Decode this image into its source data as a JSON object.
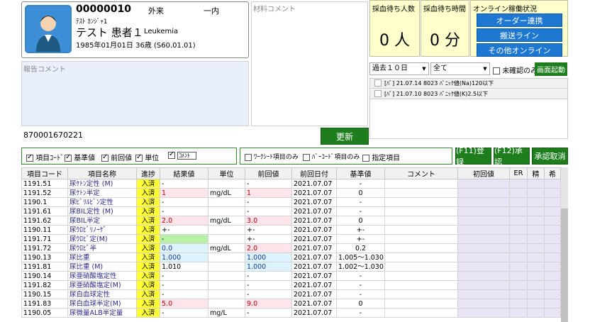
{
  "patient": {
    "id": "00000010",
    "dept": "外来",
    "ward": "一内",
    "kana": "ﾃｽﾄ  ｶﾝｼﾞｬ1",
    "name": "テスト  患者１",
    "diagnosis": "Leukemia",
    "dob": "1985年01月01日  36歳  (S60.01.01)"
  },
  "material_comment_label": "材料コメント",
  "report_comment_label": "報告コメント",
  "barcode": "870001670221",
  "update_button": "更新",
  "waiting": {
    "people_label": "採血待ち人数",
    "people_value": "0 人",
    "time_label": "採血待ち時間",
    "time_value": "0 分",
    "online_label": "オンライン稼働状況"
  },
  "online_buttons": [
    "オーダー連携",
    "搬送ライン",
    "その他オンライン"
  ],
  "period_select": "過去１０日",
  "all_select": "全て",
  "unconfirmed_label": "未確認のみ",
  "screen_start_button": "画面起動",
  "alerts": [
    "[ﾊﾟ] 21.07.14 8023 ﾊﾟﾆｯｸ値(Na)120以下",
    "[ﾊﾟ] 21.07.10 8023 ﾊﾟﾆｯｸ値(K)2.5以下"
  ],
  "filters_left": [
    {
      "label": "項目ｺｰﾄﾞ",
      "checked": true
    },
    {
      "label": "基準値",
      "checked": true
    },
    {
      "label": "前回値",
      "checked": true
    },
    {
      "label": "単位",
      "checked": true
    },
    {
      "label": "ｺﾒﾝﾄ",
      "checked": true
    }
  ],
  "filters_right": [
    {
      "label": "ﾜｰｸｼｰﾄ項目のみ",
      "checked": false
    },
    {
      "label": "ﾊﾞｰｺｰﾄﾞ項目のみ",
      "checked": false
    },
    {
      "label": "指定項目",
      "checked": false
    }
  ],
  "action_buttons": [
    "(F11)登録",
    "(F12)承認",
    "承認取消"
  ],
  "table": {
    "headers": [
      "項目コード",
      "項目名称",
      "進捗",
      "結果値",
      "単位",
      "前回値",
      "前回日付",
      "基準値",
      "コメント",
      "初回値",
      "ER",
      "精",
      "希"
    ],
    "rows": [
      {
        "code": "1191.51",
        "name": "尿ｹﾄﾝ定性 (M)",
        "prog": "入済",
        "result": "-",
        "unit": "",
        "prev": "-",
        "date": "2021.07.07",
        "ref": "-",
        "result_bg": "",
        "result_color": "",
        "prev_bg": "",
        "prev_color": ""
      },
      {
        "code": "1191.52",
        "name": "尿ｹﾄﾝ半定",
        "prog": "入済",
        "result": "1",
        "unit": "mg/dL",
        "prev": "1",
        "date": "2021.07.07",
        "ref": "0",
        "result_bg": "#ffe4ec",
        "result_color": "#c00000",
        "prev_bg": "#ffe4ec",
        "prev_color": "#c00000"
      },
      {
        "code": "1190.1",
        "name": "尿ﾋﾞﾘﾙﾋﾞﾝ定性",
        "prog": "入済",
        "result": "-",
        "unit": "",
        "prev": "-",
        "date": "2021.07.07",
        "ref": "-",
        "result_bg": "",
        "result_color": "",
        "prev_bg": "",
        "prev_color": ""
      },
      {
        "code": "1191.61",
        "name": "尿BIL定性 (M)",
        "prog": "入済",
        "result": "-",
        "unit": "",
        "prev": "-",
        "date": "2021.07.07",
        "ref": "-",
        "result_bg": "",
        "result_color": "",
        "prev_bg": "",
        "prev_color": ""
      },
      {
        "code": "1191.62",
        "name": "尿BIL半定",
        "prog": "入済",
        "result": "2.0",
        "unit": "mg/dL",
        "prev": "3.0",
        "date": "2021.07.07",
        "ref": "0",
        "result_bg": "#ffe4ec",
        "result_color": "#c00000",
        "prev_bg": "#ffe4ec",
        "prev_color": "#c00000"
      },
      {
        "code": "1190.11",
        "name": "尿ｳﾛﾋﾞﾘﾉｰｹﾞ",
        "prog": "入済",
        "result": "+-",
        "unit": "",
        "prev": "+-",
        "date": "2021.07.07",
        "ref": "+-",
        "result_bg": "",
        "result_color": "",
        "prev_bg": "",
        "prev_color": ""
      },
      {
        "code": "1191.71",
        "name": "尿ｳﾛﾋﾞ定(M)",
        "prog": "入済",
        "result": "-",
        "unit": "",
        "prev": "+-",
        "date": "2021.07.07",
        "ref": "+-",
        "result_bg": "#b8f0a8",
        "result_color": "",
        "prev_bg": "",
        "prev_color": ""
      },
      {
        "code": "1191.72",
        "name": "尿ｳﾛﾋﾞ半",
        "prog": "入済",
        "result": "0.0",
        "unit": "mg/dL",
        "prev": "2.0",
        "date": "2021.07.07",
        "ref": "0.2",
        "result_bg": "#ddf4ff",
        "result_color": "#1a3a9a",
        "prev_bg": "#ffe4ec",
        "prev_color": "#c00000"
      },
      {
        "code": "1190.13",
        "name": "尿比重",
        "prog": "入済",
        "result": "1.000",
        "unit": "",
        "prev": "1.000",
        "date": "2021.07.07",
        "ref": "1.005～1.030",
        "result_bg": "#ddf4ff",
        "result_color": "#1a3a9a",
        "prev_bg": "#ddf4ff",
        "prev_color": "#1a3a9a"
      },
      {
        "code": "1191.81",
        "name": "尿比重 (M)",
        "prog": "入済",
        "result": "1.010",
        "unit": "",
        "prev": "1.000",
        "date": "2021.07.07",
        "ref": "1.002～1.030",
        "result_bg": "",
        "result_color": "",
        "prev_bg": "#ddf4ff",
        "prev_color": "#1a3a9a"
      },
      {
        "code": "1190.14",
        "name": "尿亜硝酸塩定性",
        "prog": "入済",
        "result": "-",
        "unit": "",
        "prev": "-",
        "date": "2021.07.07",
        "ref": "-",
        "result_bg": "",
        "result_color": "",
        "prev_bg": "",
        "prev_color": ""
      },
      {
        "code": "1191.82",
        "name": "尿亜硝酸塩定(M)",
        "prog": "入済",
        "result": "-",
        "unit": "",
        "prev": "-",
        "date": "2021.07.07",
        "ref": "-",
        "result_bg": "",
        "result_color": "",
        "prev_bg": "",
        "prev_color": ""
      },
      {
        "code": "1190.15",
        "name": "尿白血球定性",
        "prog": "入済",
        "result": "-",
        "unit": "",
        "prev": "-",
        "date": "2021.07.07",
        "ref": "-",
        "result_bg": "",
        "result_color": "",
        "prev_bg": "",
        "prev_color": ""
      },
      {
        "code": "1191.83",
        "name": "尿白血球半定(M)",
        "prog": "入済",
        "result": "5.0",
        "unit": "",
        "prev": "9.0",
        "date": "2021.07.07",
        "ref": "0",
        "result_bg": "#ffe4ec",
        "result_color": "#c00000",
        "prev_bg": "#ffe4ec",
        "prev_color": "#c00000"
      },
      {
        "code": "1190.05",
        "name": "尿微量ALB半定量",
        "prog": "入済",
        "result": "-",
        "unit": "mg/L",
        "prev": "-",
        "date": "2021.07.07",
        "ref": "-",
        "result_bg": "",
        "result_color": "",
        "prev_bg": "",
        "prev_color": ""
      }
    ]
  }
}
